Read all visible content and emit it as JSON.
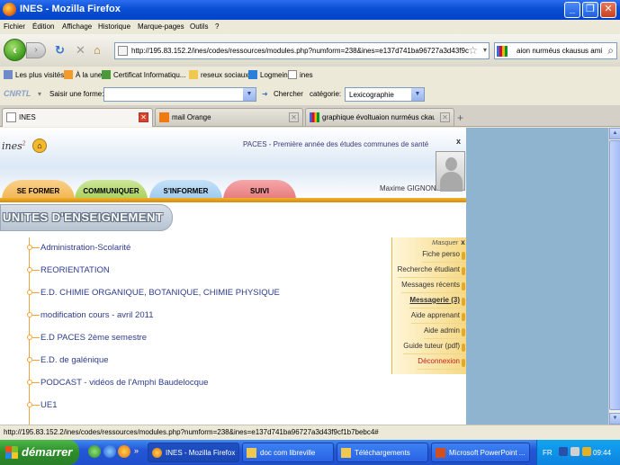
{
  "window": {
    "title": "INES - Mozilla Firefox"
  },
  "menu": [
    "Fichier",
    "Édition",
    "Affichage",
    "Historique",
    "Marque-pages",
    "Outils",
    "?"
  ],
  "nav": {
    "url": "http://195.83.152.2/ines/codes/ressources/modules.php?numform=238&ines=e137d741ba96727a3d43f9cf1b7be",
    "search_value": "aion nurméus ckausus amiens"
  },
  "bookmarks": [
    "Les plus visités",
    "À la une",
    "Certificat Informatiqu...",
    "reseux sociaux",
    "Logmein",
    "ines"
  ],
  "cnrtl": {
    "logo": "CNRTL",
    "form_label": "Saisir une forme:",
    "form_value": "",
    "search_button": "Chercher",
    "category_label": "catégorie:",
    "category_value": "Lexicographie"
  },
  "tabs": [
    {
      "label": "INES",
      "active": true
    },
    {
      "label": "mail Orange",
      "active": false
    },
    {
      "label": "graphique évoltuaion nurméus ckausus ...",
      "active": false
    }
  ],
  "page": {
    "logo_text": "ines",
    "logo_sup": "2",
    "program": "PACES - Première année des études communes de santé",
    "close": "x",
    "user_name": "Maxime GIGNON",
    "nav_tabs": [
      {
        "label": "SE FORMER",
        "color": "#f2b552"
      },
      {
        "label": "COMMUNIQUER",
        "color": "#a8d15a"
      },
      {
        "label": "S'INFORMER",
        "color": "#9cc9ee"
      },
      {
        "label": "SUIVI",
        "color": "#e8797c"
      }
    ],
    "section_title": "UNITES D'ENSEIGNEMENT",
    "ue_items": [
      "Administration-Scolarité",
      "REORIENTATION",
      "E.D. CHIMIE ORGANIQUE, BOTANIQUE, CHIMIE PHYSIQUE",
      "modification cours - avril 2011",
      "E.D PACES 2ème semestre",
      "E.D. de galénique",
      "PODCAST - vidéos de l'Amphi Baudelocque",
      "UE1"
    ],
    "side_menu": {
      "hide_label": "Masquer",
      "hide_close": "x",
      "items": [
        {
          "label": "Fiche perso",
          "style": "normal"
        },
        {
          "label": "Recherche étudiant",
          "style": "normal"
        },
        {
          "label": "Messages récents",
          "style": "normal"
        },
        {
          "label": "Messagerie (3)",
          "style": "bold"
        },
        {
          "label": "Aide apprenant",
          "style": "normal"
        },
        {
          "label": "Aide admin",
          "style": "normal"
        },
        {
          "label": "Guide tuteur (pdf)",
          "style": "normal"
        },
        {
          "label": "Déconnexion",
          "style": "red"
        }
      ]
    }
  },
  "status": "http://195.83.152.2/ines/codes/ressources/modules.php?numform=238&ines=e137d741ba96727a3d43f9cf1b7bebc4#",
  "taskbar": {
    "start_label": "démarrer",
    "tasks": [
      {
        "label": "INES - Mozilla Firefox",
        "active": true
      },
      {
        "label": "doc com libreville",
        "active": false
      },
      {
        "label": "Téléchargements",
        "active": false
      },
      {
        "label": "Microsoft PowerPoint ...",
        "active": false
      }
    ],
    "lang": "FR",
    "clock": "09:44"
  }
}
